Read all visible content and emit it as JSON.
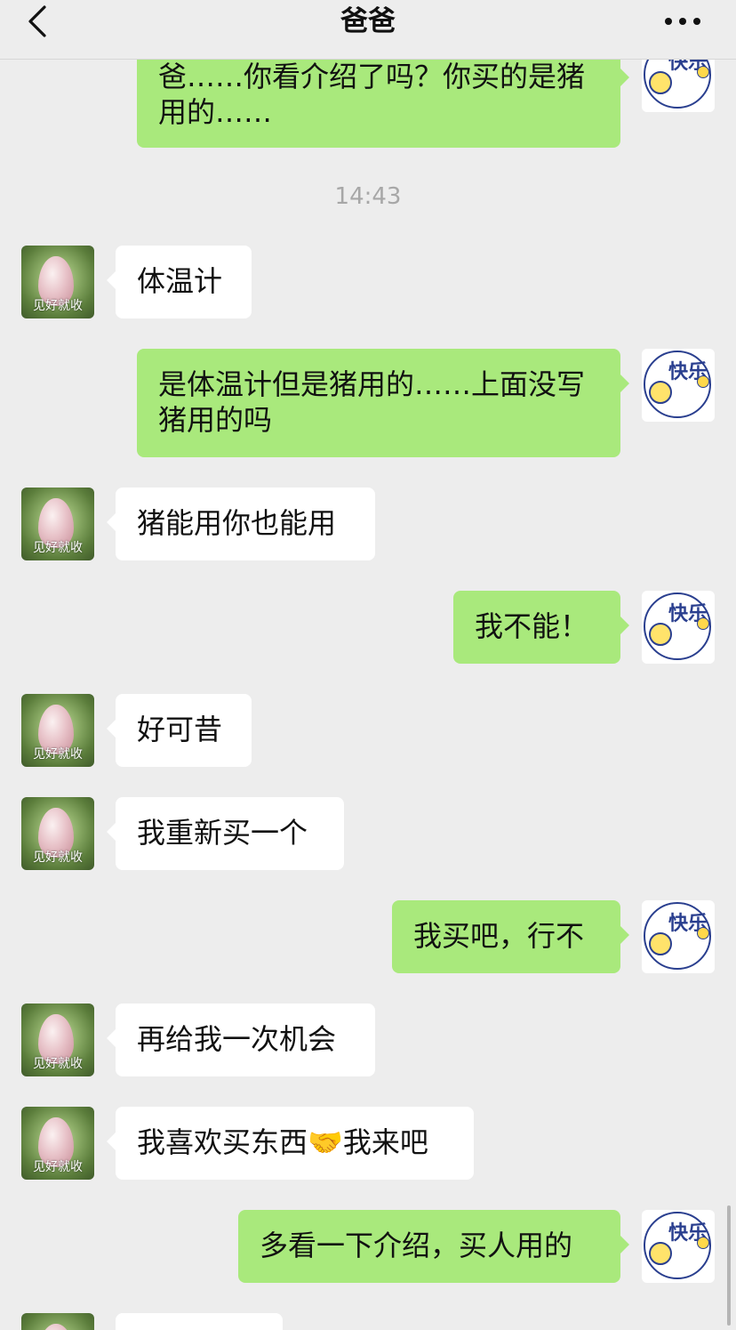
{
  "header": {
    "title": "爸爸",
    "back_icon": "chevron-left-icon",
    "more_icon": "more-dots-icon"
  },
  "avatars": {
    "dad_caption": "见好就收",
    "me_text": "快乐"
  },
  "timestamp": "14:43",
  "messages": [
    {
      "side": "right",
      "text": "爸……你看介绍了吗？你买的是猪\n用的……"
    },
    {
      "side": "left",
      "text": "体温计"
    },
    {
      "side": "right",
      "text": "是体温计但是猪用的……上面没写\n猪用的吗"
    },
    {
      "side": "left",
      "text": "猪能用你也能用"
    },
    {
      "side": "right",
      "text": "我不能！"
    },
    {
      "side": "left",
      "text": "好可昔"
    },
    {
      "side": "left",
      "text": "我重新买一个"
    },
    {
      "side": "right",
      "text": "我买吧，行不"
    },
    {
      "side": "left",
      "text": "再给我一次机会"
    },
    {
      "side": "left",
      "text": "我喜欢买东西🤝我来吧"
    },
    {
      "side": "right",
      "text": "多看一下介绍，买人用的"
    }
  ],
  "colors": {
    "background": "#ededed",
    "bubble_right": "#a9e97c",
    "bubble_left": "#ffffff"
  }
}
